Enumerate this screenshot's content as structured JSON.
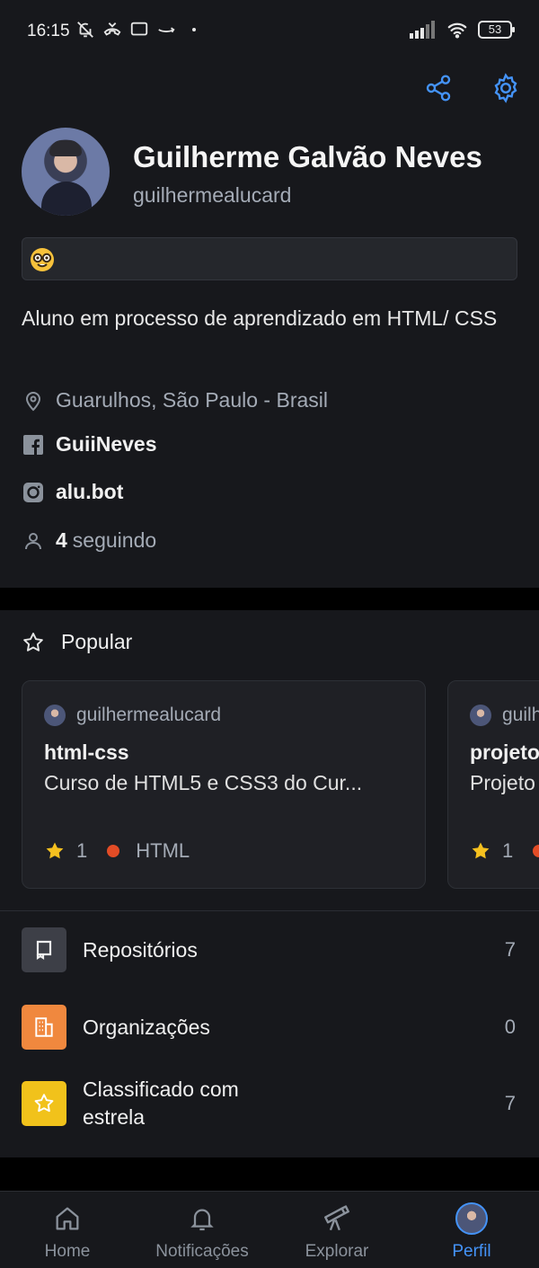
{
  "status_bar": {
    "time": "16:15",
    "battery": "53",
    "icons_left": [
      "bell-muted-icon",
      "missed-call-icon",
      "message-icon",
      "amazon-icon",
      "dot-icon"
    ],
    "icons_right": [
      "signal-icon",
      "wifi-icon",
      "battery-icon"
    ]
  },
  "app_bar": {
    "actions": [
      "share-icon",
      "settings-icon"
    ],
    "accent_color": "#4493f8"
  },
  "profile": {
    "full_name": "Guilherme Galvão Neves",
    "username": "guilhermealucard",
    "status_emoji": "🤓",
    "bio": "Aluno em processo de aprendizado em HTML/ CSS",
    "location": "Guarulhos, São Paulo - Brasil",
    "facebook": "GuiiNeves",
    "instagram": "alu.bot",
    "following_count": "4",
    "following_label": "seguindo"
  },
  "popular": {
    "title": "Popular",
    "cards": [
      {
        "owner": "guilhermealucard",
        "name": "html-css",
        "description": "Curso de HTML5 e CSS3 do Cur...",
        "stars": "1",
        "language": "HTML",
        "language_color": "#e34c26"
      },
      {
        "owner": "guilhermealucard",
        "name": "projeto",
        "description": "Projeto",
        "stars": "1",
        "language": "",
        "language_color": "#e34c26"
      }
    ]
  },
  "lists": [
    {
      "label": "Repositórios",
      "count": "7",
      "icon": "repo-icon",
      "color": "#3d3f47"
    },
    {
      "label": "Organizações",
      "count": "0",
      "icon": "organization-icon",
      "color": "#f0883e"
    },
    {
      "label": "Classificado com estrela",
      "count": "7",
      "icon": "star-icon",
      "color": "#f1c21b"
    }
  ],
  "bottom_nav": [
    {
      "label": "Home",
      "icon": "home-icon",
      "active": false
    },
    {
      "label": "Notificações",
      "icon": "bell-icon",
      "active": false
    },
    {
      "label": "Explorar",
      "icon": "telescope-icon",
      "active": false
    },
    {
      "label": "Perfil",
      "icon": "avatar",
      "active": true
    }
  ]
}
